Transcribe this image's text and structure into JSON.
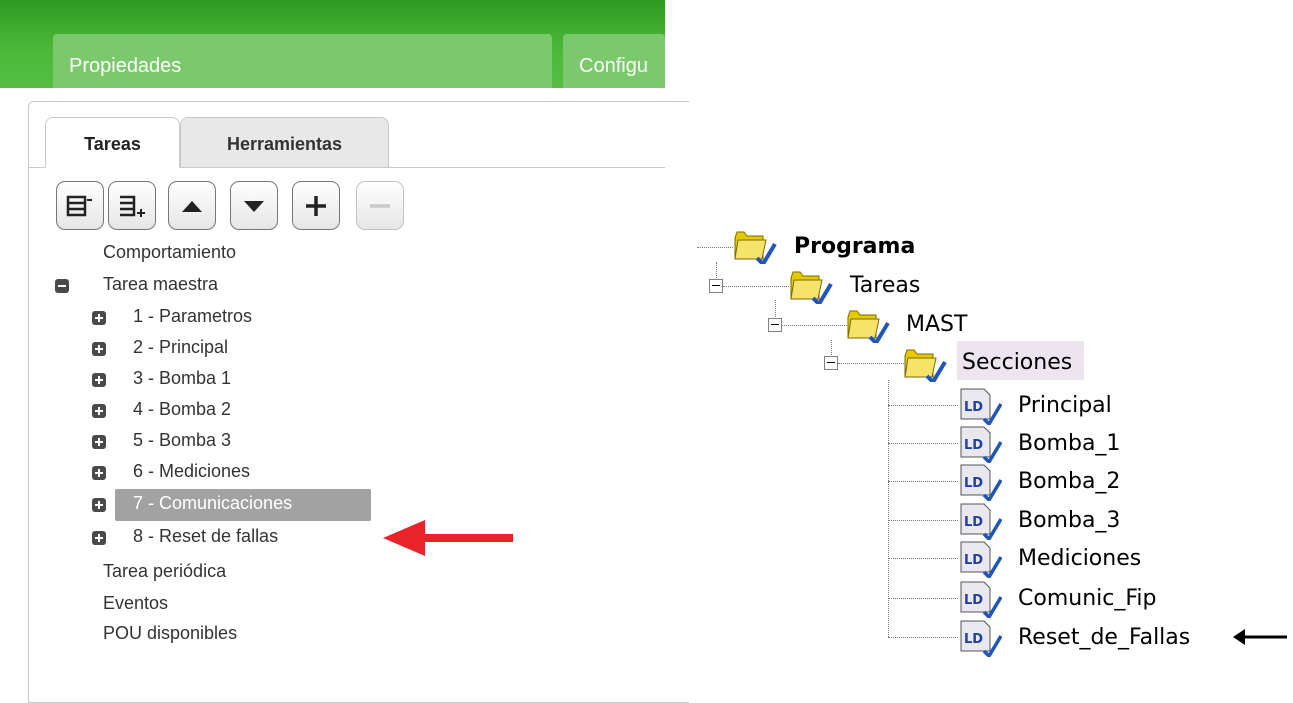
{
  "top_tabs": [
    "Propiedades",
    "Configu"
  ],
  "panel_tabs": {
    "active": "Tareas",
    "inactive": "Herramientas"
  },
  "toolbar": [
    {
      "name": "collapse-all-icon"
    },
    {
      "name": "expand-all-icon"
    },
    {
      "name": "move-up-icon"
    },
    {
      "name": "move-down-icon"
    },
    {
      "name": "add-icon"
    },
    {
      "name": "remove-icon",
      "disabled": true
    }
  ],
  "left_tree": {
    "comportamiento": "Comportamiento",
    "tarea_maestra": "Tarea maestra",
    "items": [
      "1 - Parametros",
      "2 - Principal",
      "3 - Bomba 1",
      "4 - Bomba 2",
      "5 - Bomba 3",
      "6 - Mediciones",
      "7 - Comunicaciones",
      "8 - Reset de fallas"
    ],
    "selected_index": 6,
    "tarea_periodica": "Tarea periódica",
    "eventos": "Eventos",
    "pou": "POU disponibles"
  },
  "right_tree": {
    "programa": "Programa",
    "tareas": "Tareas",
    "mast": "MAST",
    "secciones": "Secciones",
    "sections": [
      "Principal",
      "Bomba_1",
      "Bomba_2",
      "Bomba_3",
      "Mediciones",
      "Comunic_Fip",
      "Reset_de_Fallas"
    ],
    "ld_label": "LD"
  },
  "colors": {
    "green_bar": "#4cb83a",
    "tab_green": "#7cc86d",
    "red_arrow": "#e8232a",
    "selection": "#a2a2a2",
    "highlight": "#ece4ee"
  }
}
